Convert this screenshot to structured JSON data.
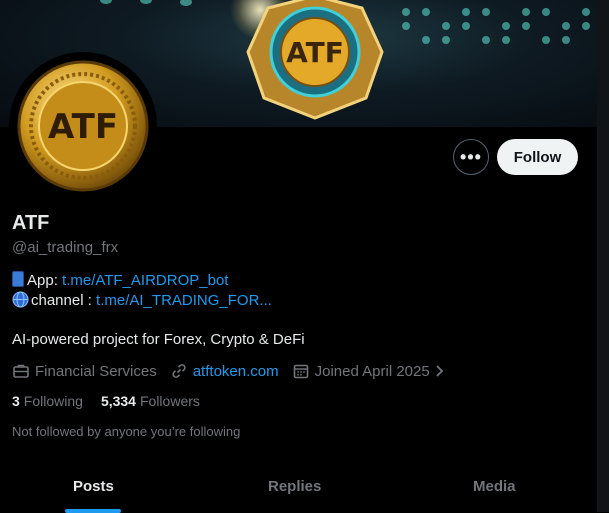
{
  "profile": {
    "name": "ATF",
    "handle": "@ai_trading_frx",
    "avatar_text": "ATF",
    "banner_emblem_text": "ATF",
    "bio": {
      "app_prefix": "App: ",
      "app_link": "t.me/ATF_AIRDROP_bot",
      "channel_prefix": "channel : ",
      "channel_link": "t.me/AI_TRADING_FOR..."
    },
    "description": "AI-powered project for Forex, Crypto & DeFi",
    "meta": {
      "category": "Financial Services",
      "website": "atftoken.com",
      "joined": "Joined April 2025"
    },
    "stats": {
      "following_count": "3",
      "following_label": "Following",
      "followers_count": "5,334",
      "followers_label": "Followers"
    },
    "not_followed_text": "Not followed by anyone you’re following"
  },
  "actions": {
    "more_label": "•••",
    "follow_label": "Follow"
  },
  "tabs": [
    {
      "label": "Posts",
      "active": true
    },
    {
      "label": "Replies",
      "active": false
    },
    {
      "label": "Media",
      "active": false
    }
  ],
  "colors": {
    "background": "#000000",
    "accent": "#1d9bf0",
    "text_primary": "#e7e9ea",
    "text_secondary": "#71767b",
    "follow_button": "#eff3f4",
    "gold": "#d4a017"
  },
  "icons": [
    "briefcase-icon",
    "link-icon",
    "calendar-icon",
    "chevron-right-icon",
    "phone-emoji-icon",
    "globe-emoji-icon",
    "more-icon"
  ]
}
